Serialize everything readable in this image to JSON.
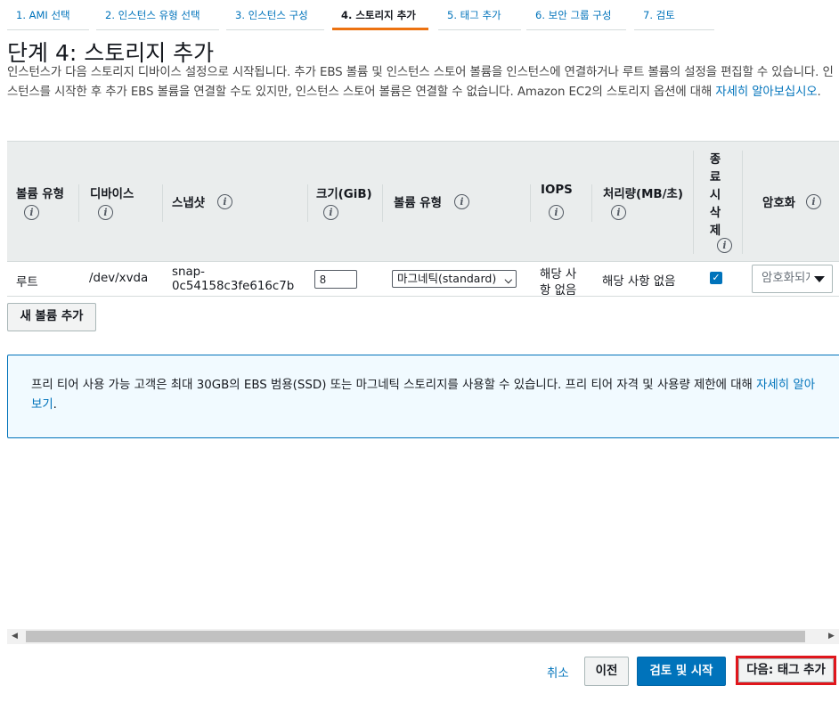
{
  "wizard_tabs": [
    {
      "label": "1. AMI 선택",
      "active": false
    },
    {
      "label": "2. 인스턴스 유형 선택",
      "active": false
    },
    {
      "label": "3. 인스턴스 구성",
      "active": false
    },
    {
      "label": "4. 스토리지 추가",
      "active": true
    },
    {
      "label": "5. 태그 추가",
      "active": false
    },
    {
      "label": "6. 보안 그룹 구성",
      "active": false
    },
    {
      "label": "7. 검토",
      "active": false
    }
  ],
  "page": {
    "title": "단계 4: 스토리지 추가",
    "description": "인스턴스가 다음 스토리지 디바이스 설정으로 시작됩니다. 추가 EBS 볼륨 및 인스턴스 스토어 볼륨을 인스턴스에 연결하거나 루트 볼륨의 설정을 편집할 수 있습니다. 인스턴스를 시작한 후 추가 EBS 볼륨을 연결할 수도 있지만, 인스턴스 스토어 볼륨은 연결할 수 없습니다. Amazon EC2의 스토리지 옵션에 대해",
    "learn_more_link": "자세히 알아보십시오",
    "description_end": "."
  },
  "table": {
    "headers": {
      "volume_type": "볼륨 유형",
      "device": "디바이스",
      "snapshot": "스냅샷",
      "size": "크기(GiB)",
      "ebs_volume_type": "볼륨 유형",
      "iops": "IOPS",
      "throughput": "처리량(MB/초)",
      "delete_on_termination": [
        "종",
        "료",
        "시",
        "삭",
        "제"
      ],
      "encryption": "암호화"
    },
    "info_icon_glyph": "i",
    "rows": [
      {
        "volume_type": "루트",
        "device": "/dev/xvda",
        "snapshot_line1": "snap-",
        "snapshot_line2": "0c54158c3fe616c7b",
        "size": "8",
        "ebs_volume_type": "마그네틱(standard)",
        "iops_line1": "해당 사",
        "iops_line2": "항 없음",
        "throughput": "해당 사항 없음",
        "delete_on_termination": true,
        "encryption": "암호화되지 않음"
      }
    ],
    "add_volume_label": "새 볼륨 추가"
  },
  "free_tier_notice": {
    "text": "프리 티어 사용 가능 고객은 최대 30GB의 EBS 범용(SSD) 또는 마그네틱 스토리지를 사용할 수 있습니다. 프리 티어 자격 및 사용량 제한에 대해",
    "link": "자세히 알아보기",
    "end": "."
  },
  "footer": {
    "cancel_label": "취소",
    "previous_label": "이전",
    "review_launch_label": "검토 및 시작",
    "next_label": "다음: 태그 추가"
  },
  "colors": {
    "accent_tab": "#ec7211",
    "link": "#0073bb",
    "primary_button": "#0073bb",
    "highlight_frame": "#e0161c",
    "notice_background": "#f1faff"
  }
}
